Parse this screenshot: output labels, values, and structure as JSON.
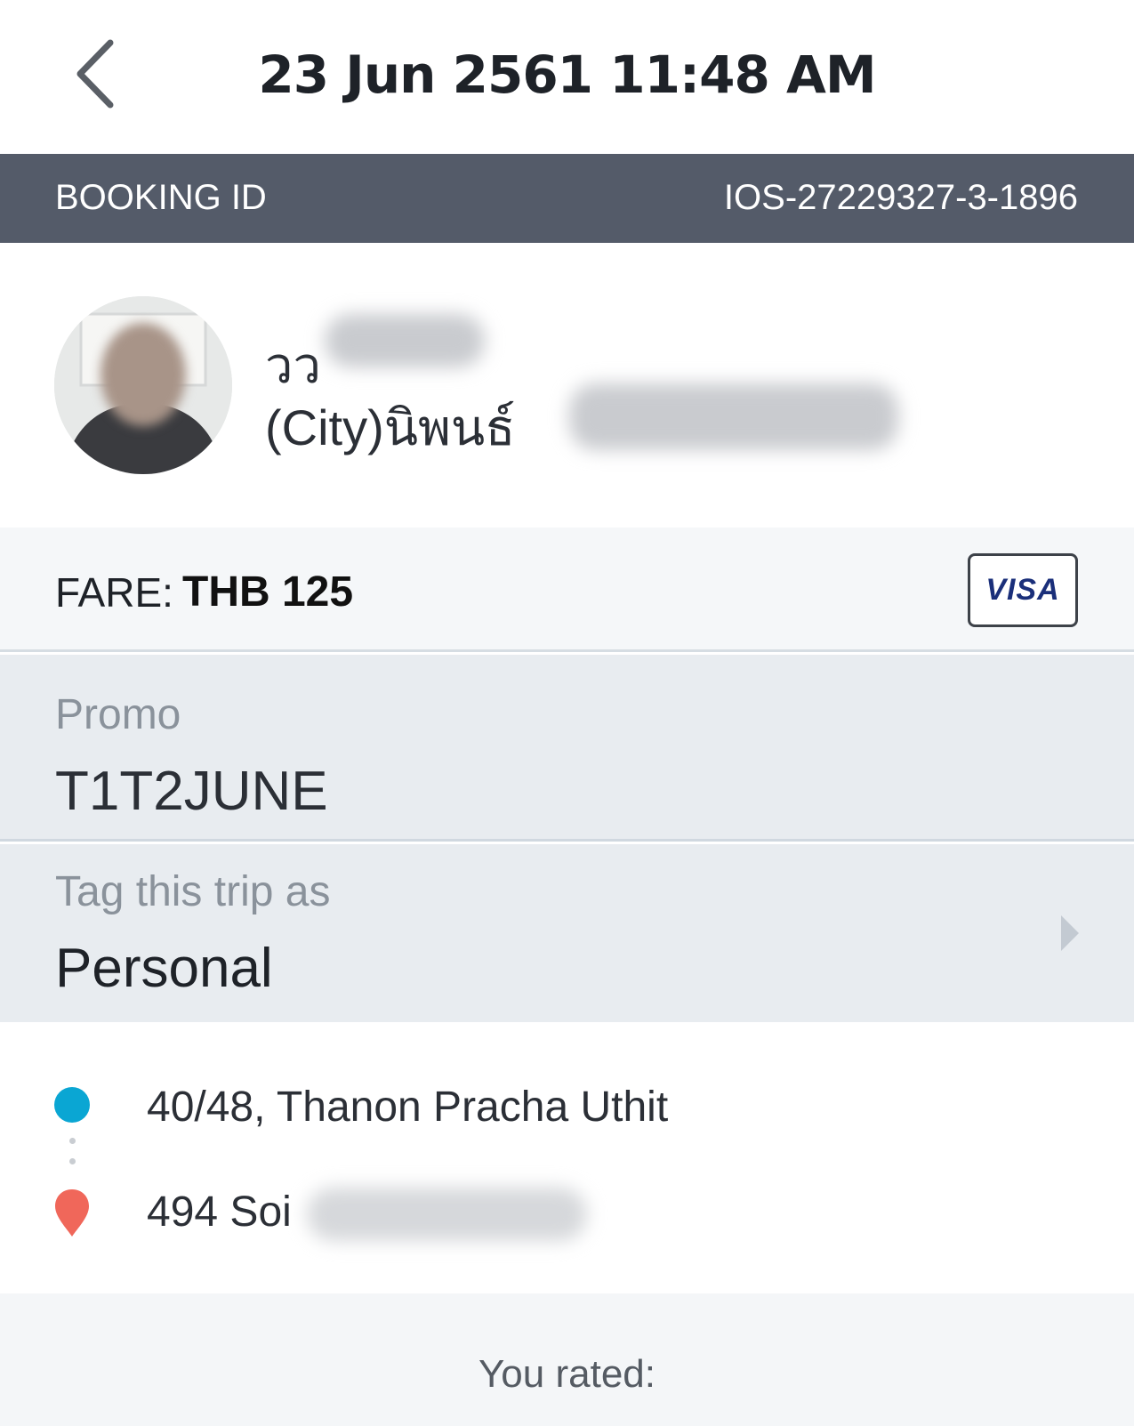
{
  "header": {
    "title": "23 Jun 2561 11:48 AM",
    "back_icon": "chevron-left-icon"
  },
  "booking": {
    "label": "BOOKING ID",
    "id": "IOS-27229327-3-1896"
  },
  "driver": {
    "name": "วว",
    "subtitle": "(City)นิพนธ์"
  },
  "fare": {
    "label": "FARE:",
    "amount": "THB 125",
    "payment_method": "VISA"
  },
  "promo": {
    "label": "Promo",
    "code": "T1T2JUNE"
  },
  "tag": {
    "label": "Tag this trip as",
    "value": "Personal"
  },
  "route": {
    "pickup": "40/48, Thanon Pracha Uthit",
    "dropoff": "494 Soi"
  },
  "rating": {
    "label": "You rated:"
  },
  "colors": {
    "booking_bar": "#545b69",
    "pickup_dot": "#0aa6d3",
    "dropoff_pin": "#f0675a"
  }
}
